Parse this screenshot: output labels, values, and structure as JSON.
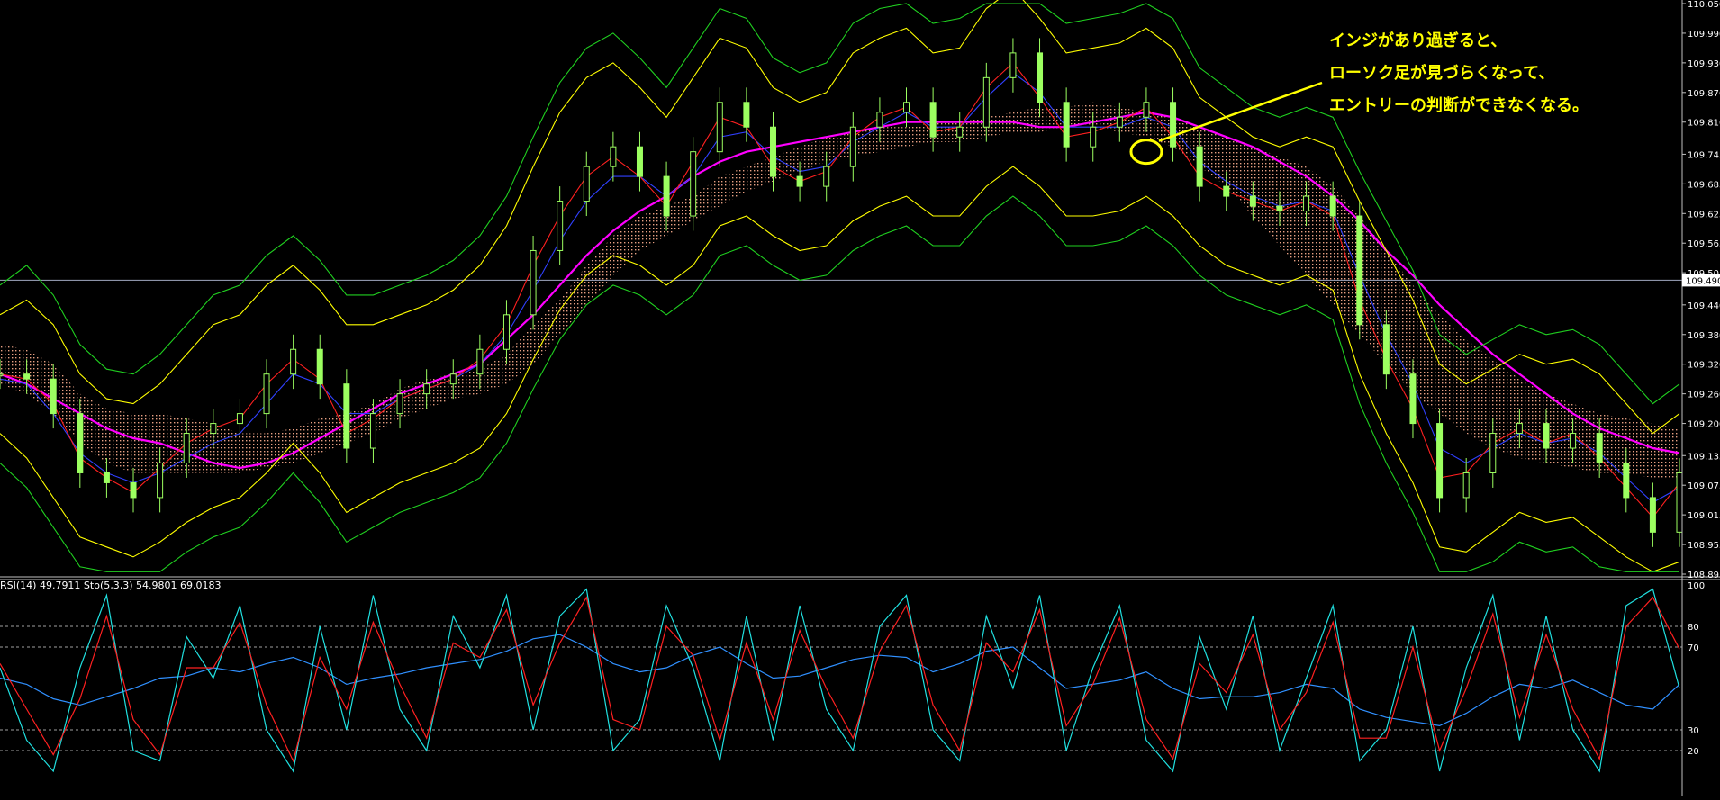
{
  "chart_data": [
    {
      "type": "line",
      "panel": "main",
      "subtype": "candlestick-with-indicators",
      "title": "",
      "ylim": [
        108.895,
        110.05
      ],
      "y_ticks": [
        110.05,
        109.99,
        109.93,
        109.87,
        109.81,
        109.745,
        109.685,
        109.625,
        109.565,
        109.505,
        109.44,
        109.38,
        109.32,
        109.26,
        109.2,
        109.135,
        109.075,
        109.015,
        108.955,
        108.895
      ],
      "current_price": 109.49,
      "current_price_label": "109.490",
      "price_series": [
        109.3,
        109.29,
        109.22,
        109.1,
        109.08,
        109.05,
        109.12,
        109.18,
        109.2,
        109.22,
        109.3,
        109.35,
        109.28,
        109.15,
        109.22,
        109.26,
        109.28,
        109.3,
        109.35,
        109.42,
        109.55,
        109.65,
        109.72,
        109.76,
        109.7,
        109.62,
        109.75,
        109.85,
        109.8,
        109.7,
        109.68,
        109.72,
        109.8,
        109.83,
        109.85,
        109.78,
        109.8,
        109.9,
        109.95,
        109.85,
        109.76,
        109.8,
        109.82,
        109.85,
        109.76,
        109.68,
        109.66,
        109.64,
        109.63,
        109.66,
        109.62,
        109.4,
        109.3,
        109.2,
        109.05,
        109.1,
        109.18,
        109.2,
        109.15,
        109.18,
        109.12,
        109.05,
        108.98,
        109.1
      ],
      "series": [
        {
          "name": "Moving average 1",
          "color": "#ff00ff",
          "values": [
            109.3,
            109.28,
            109.25,
            109.22,
            109.19,
            109.17,
            109.16,
            109.14,
            109.12,
            109.11,
            109.12,
            109.14,
            109.17,
            109.2,
            109.23,
            109.26,
            109.28,
            109.3,
            109.32,
            109.37,
            109.42,
            109.48,
            109.54,
            109.59,
            109.63,
            109.66,
            109.7,
            109.73,
            109.75,
            109.76,
            109.77,
            109.78,
            109.79,
            109.8,
            109.81,
            109.81,
            109.81,
            109.81,
            109.81,
            109.8,
            109.8,
            109.81,
            109.82,
            109.83,
            109.82,
            109.8,
            109.78,
            109.76,
            109.73,
            109.7,
            109.66,
            109.61,
            109.55,
            109.5,
            109.44,
            109.39,
            109.34,
            109.3,
            109.26,
            109.22,
            109.19,
            109.17,
            109.15,
            109.14
          ]
        },
        {
          "name": "Moving average 2",
          "color": "#3040ff",
          "values": [
            109.29,
            109.28,
            109.22,
            109.14,
            109.1,
            109.08,
            109.1,
            109.13,
            109.16,
            109.18,
            109.24,
            109.3,
            109.28,
            109.22,
            109.22,
            109.25,
            109.27,
            109.29,
            109.32,
            109.38,
            109.47,
            109.57,
            109.65,
            109.7,
            109.7,
            109.66,
            109.7,
            109.78,
            109.79,
            109.74,
            109.71,
            109.72,
            109.77,
            109.8,
            109.83,
            109.8,
            109.8,
            109.86,
            109.91,
            109.87,
            109.8,
            109.8,
            109.8,
            109.82,
            109.8,
            109.73,
            109.69,
            109.66,
            109.64,
            109.65,
            109.63,
            109.5,
            109.38,
            109.28,
            109.15,
            109.12,
            109.15,
            109.18,
            109.16,
            109.17,
            109.14,
            109.09,
            109.04,
            109.07
          ]
        },
        {
          "name": "Moving average 3",
          "color": "#ff2020",
          "values": [
            109.3,
            109.29,
            109.24,
            109.13,
            109.09,
            109.06,
            109.11,
            109.16,
            109.19,
            109.21,
            109.28,
            109.33,
            109.29,
            109.18,
            109.21,
            109.25,
            109.27,
            109.29,
            109.33,
            109.4,
            109.52,
            109.62,
            109.7,
            109.74,
            109.7,
            109.64,
            109.73,
            109.82,
            109.8,
            109.72,
            109.69,
            109.71,
            109.78,
            109.82,
            109.84,
            109.79,
            109.8,
            109.88,
            109.93,
            109.86,
            109.78,
            109.79,
            109.81,
            109.84,
            109.78,
            109.7,
            109.67,
            109.65,
            109.63,
            109.65,
            109.62,
            109.45,
            109.33,
            109.23,
            109.09,
            109.1,
            109.16,
            109.19,
            109.16,
            109.18,
            109.13,
            109.07,
            109.01,
            109.08
          ]
        },
        {
          "name": "Bollinger upper",
          "color": "#ffff00",
          "values": [
            109.42,
            109.45,
            109.4,
            109.3,
            109.25,
            109.24,
            109.28,
            109.34,
            109.4,
            109.42,
            109.48,
            109.52,
            109.47,
            109.4,
            109.4,
            109.42,
            109.44,
            109.47,
            109.52,
            109.6,
            109.72,
            109.83,
            109.9,
            109.93,
            109.88,
            109.82,
            109.9,
            109.98,
            109.96,
            109.88,
            109.85,
            109.87,
            109.95,
            109.98,
            110.0,
            109.95,
            109.96,
            110.04,
            110.08,
            110.02,
            109.95,
            109.96,
            109.97,
            110.0,
            109.96,
            109.86,
            109.82,
            109.78,
            109.76,
            109.78,
            109.76,
            109.65,
            109.55,
            109.45,
            109.32,
            109.28,
            109.31,
            109.34,
            109.32,
            109.33,
            109.3,
            109.24,
            109.18,
            109.22
          ]
        },
        {
          "name": "Bollinger lower",
          "color": "#ffff00",
          "values": [
            109.18,
            109.13,
            109.05,
            108.97,
            108.95,
            108.93,
            108.96,
            109.0,
            109.03,
            109.05,
            109.1,
            109.16,
            109.1,
            109.02,
            109.05,
            109.08,
            109.1,
            109.12,
            109.15,
            109.22,
            109.33,
            109.43,
            109.5,
            109.54,
            109.52,
            109.48,
            109.52,
            109.6,
            109.62,
            109.58,
            109.55,
            109.56,
            109.61,
            109.64,
            109.66,
            109.62,
            109.62,
            109.68,
            109.72,
            109.68,
            109.62,
            109.62,
            109.63,
            109.66,
            109.62,
            109.56,
            109.52,
            109.5,
            109.48,
            109.5,
            109.47,
            109.3,
            109.18,
            109.08,
            108.95,
            108.94,
            108.98,
            109.02,
            109.0,
            109.01,
            108.97,
            108.93,
            108.9,
            108.92
          ]
        },
        {
          "name": "Envelope upper",
          "color": "#20d020",
          "values": [
            109.48,
            109.52,
            109.46,
            109.36,
            109.31,
            109.3,
            109.34,
            109.4,
            109.46,
            109.48,
            109.54,
            109.58,
            109.53,
            109.46,
            109.46,
            109.48,
            109.5,
            109.53,
            109.58,
            109.66,
            109.78,
            109.89,
            109.96,
            109.99,
            109.94,
            109.88,
            109.96,
            110.04,
            110.02,
            109.94,
            109.91,
            109.93,
            110.01,
            110.04,
            110.05,
            110.01,
            110.02,
            110.05,
            110.05,
            110.05,
            110.01,
            110.02,
            110.03,
            110.05,
            110.02,
            109.92,
            109.88,
            109.84,
            109.82,
            109.84,
            109.82,
            109.71,
            109.61,
            109.51,
            109.38,
            109.34,
            109.37,
            109.4,
            109.38,
            109.39,
            109.36,
            109.3,
            109.24,
            109.28
          ]
        },
        {
          "name": "Envelope lower",
          "color": "#20d020",
          "values": [
            109.12,
            109.07,
            108.99,
            108.91,
            108.9,
            108.9,
            108.9,
            108.94,
            108.97,
            108.99,
            109.04,
            109.1,
            109.04,
            108.96,
            108.99,
            109.02,
            109.04,
            109.06,
            109.09,
            109.16,
            109.27,
            109.37,
            109.44,
            109.48,
            109.46,
            109.42,
            109.46,
            109.54,
            109.56,
            109.52,
            109.49,
            109.5,
            109.55,
            109.58,
            109.6,
            109.56,
            109.56,
            109.62,
            109.66,
            109.62,
            109.56,
            109.56,
            109.57,
            109.6,
            109.56,
            109.5,
            109.46,
            109.44,
            109.42,
            109.44,
            109.41,
            109.24,
            109.12,
            109.02,
            108.9,
            108.9,
            108.92,
            108.96,
            108.94,
            108.95,
            108.91,
            108.9,
            108.9,
            108.9
          ]
        }
      ],
      "cloud": {
        "name": "Ichimoku cloud",
        "color": "#ffb090",
        "upper": [
          109.36,
          109.35,
          109.32,
          109.26,
          109.23,
          109.22,
          109.22,
          109.21,
          109.2,
          109.18,
          109.18,
          109.19,
          109.21,
          109.22,
          109.24,
          109.27,
          109.29,
          109.3,
          109.31,
          109.34,
          109.4,
          109.45,
          109.52,
          109.58,
          109.62,
          109.64,
          109.66,
          109.7,
          109.72,
          109.74,
          109.76,
          109.78,
          109.79,
          109.8,
          109.8,
          109.81,
          109.81,
          109.82,
          109.83,
          109.84,
          109.84,
          109.85,
          109.84,
          109.83,
          109.82,
          109.8,
          109.78,
          109.76,
          109.74,
          109.72,
          109.68,
          109.62,
          109.55,
          109.48,
          109.42,
          109.37,
          109.33,
          109.29,
          109.26,
          109.24,
          109.22,
          109.21,
          109.2,
          109.19
        ],
        "lower": [
          109.28,
          109.26,
          109.22,
          109.16,
          109.12,
          109.1,
          109.1,
          109.1,
          109.1,
          109.1,
          109.11,
          109.12,
          109.14,
          109.16,
          109.18,
          109.21,
          109.23,
          109.25,
          109.26,
          109.28,
          109.32,
          109.38,
          109.44,
          109.5,
          109.55,
          109.58,
          109.61,
          109.64,
          109.67,
          109.69,
          109.71,
          109.73,
          109.74,
          109.75,
          109.76,
          109.77,
          109.77,
          109.78,
          109.79,
          109.79,
          109.8,
          109.8,
          109.79,
          109.78,
          109.76,
          109.72,
          109.68,
          109.62,
          109.56,
          109.5,
          109.44,
          109.38,
          109.32,
          109.26,
          109.22,
          109.18,
          109.15,
          109.13,
          109.12,
          109.11,
          109.1,
          109.1,
          109.09,
          109.09
        ]
      },
      "annotation": {
        "lines": [
          "インジがあり過ぎると、",
          "ローソク足が見づらくなって、",
          "エントリーの判断ができなくなる。"
        ],
        "color": "#ffff00",
        "marked_point": {
          "index": 43,
          "value": 109.75
        }
      }
    },
    {
      "type": "line",
      "panel": "oscillator",
      "label": "RSI(14) 49.7911  Sto(5,3,3) 54.9801 69.0183",
      "ylim": [
        0,
        100
      ],
      "y_ticks": [
        100,
        80,
        70,
        30,
        20
      ],
      "levels": [
        80,
        70,
        30,
        20
      ],
      "series": [
        {
          "name": "RSI(14)",
          "color": "#3090ff",
          "values": [
            55,
            52,
            45,
            42,
            46,
            50,
            55,
            56,
            60,
            58,
            62,
            65,
            60,
            52,
            55,
            57,
            60,
            62,
            64,
            68,
            74,
            76,
            70,
            62,
            58,
            60,
            66,
            70,
            62,
            55,
            56,
            60,
            64,
            66,
            65,
            58,
            62,
            68,
            70,
            60,
            50,
            52,
            54,
            58,
            50,
            45,
            46,
            46,
            48,
            52,
            50,
            40,
            36,
            34,
            32,
            38,
            46,
            52,
            50,
            54,
            48,
            42,
            40,
            52
          ]
        },
        {
          "name": "Sto %K",
          "color": "#20e0e0",
          "values": [
            60,
            25,
            10,
            60,
            95,
            20,
            15,
            75,
            55,
            90,
            30,
            10,
            80,
            30,
            95,
            40,
            20,
            85,
            60,
            95,
            30,
            85,
            98,
            20,
            35,
            90,
            60,
            15,
            85,
            25,
            90,
            40,
            20,
            80,
            95,
            30,
            15,
            85,
            50,
            95,
            20,
            60,
            90,
            25,
            10,
            75,
            40,
            85,
            20,
            55,
            90,
            15,
            30,
            80,
            10,
            60,
            95,
            25,
            85,
            30,
            10,
            90,
            98,
            50
          ]
        },
        {
          "name": "Sto %D",
          "color": "#ff2020",
          "values": [
            62,
            40,
            18,
            45,
            85,
            35,
            18,
            60,
            60,
            82,
            42,
            15,
            65,
            40,
            82,
            52,
            26,
            72,
            65,
            88,
            42,
            72,
            94,
            35,
            30,
            80,
            66,
            25,
            72,
            35,
            78,
            50,
            26,
            68,
            90,
            42,
            20,
            72,
            58,
            88,
            32,
            52,
            84,
            35,
            16,
            62,
            48,
            76,
            30,
            48,
            82,
            26,
            26,
            70,
            20,
            50,
            86,
            36,
            76,
            40,
            16,
            80,
            94,
            69
          ]
        }
      ]
    }
  ]
}
